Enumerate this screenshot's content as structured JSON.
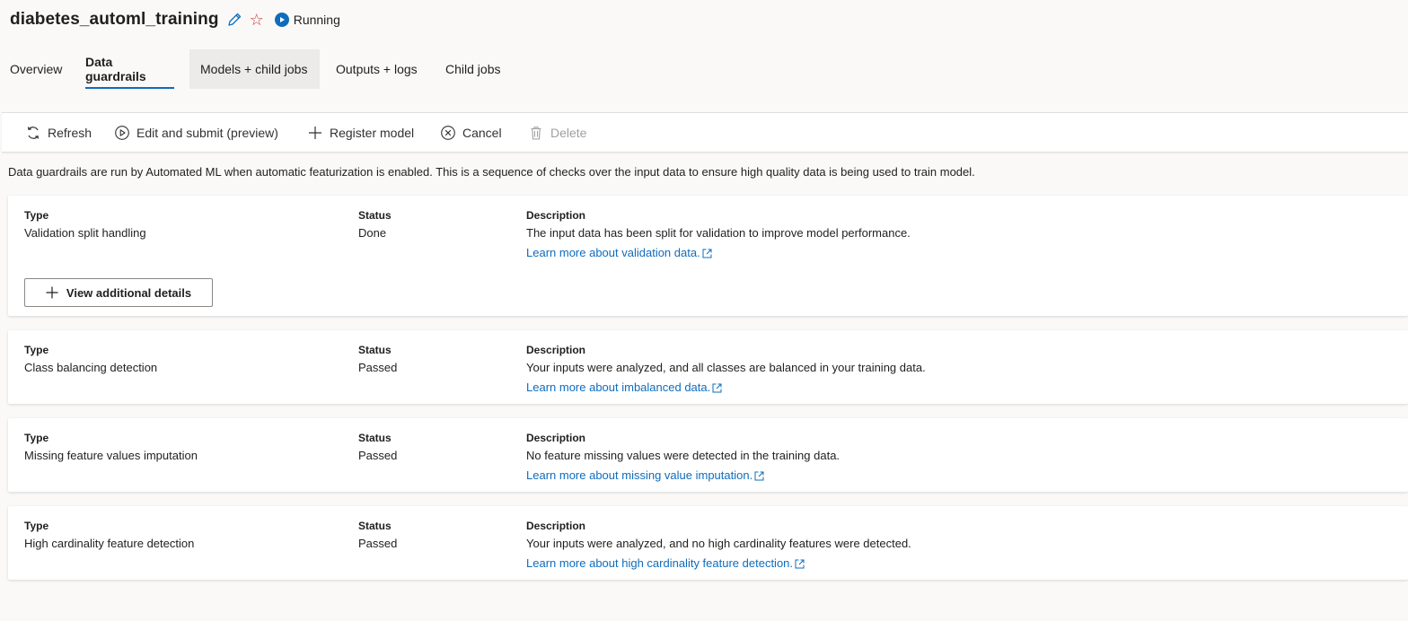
{
  "header": {
    "job_name": "diabetes_automl_training",
    "status": "Running"
  },
  "tabs": [
    {
      "label": "Overview"
    },
    {
      "label": "Data guardrails"
    },
    {
      "label": "Models + child jobs"
    },
    {
      "label": "Outputs + logs"
    },
    {
      "label": "Child jobs"
    }
  ],
  "toolbar": {
    "refresh": "Refresh",
    "edit_submit": "Edit and submit (preview)",
    "register_model": "Register model",
    "cancel": "Cancel",
    "delete": "Delete"
  },
  "intro": "Data guardrails are run by Automated ML when automatic featurization is enabled. This is a sequence of checks over the input data to ensure high quality data is being used to train model.",
  "columns": {
    "type": "Type",
    "status": "Status",
    "description": "Description"
  },
  "guardrails": [
    {
      "type": "Validation split handling",
      "status": "Done",
      "description": "The input data has been split for validation to improve model performance.",
      "link": "Learn more about validation data.",
      "details_button": "View additional details"
    },
    {
      "type": "Class balancing detection",
      "status": "Passed",
      "description": "Your inputs were analyzed, and all classes are balanced in your training data.",
      "link": "Learn more about imbalanced data."
    },
    {
      "type": "Missing feature values imputation",
      "status": "Passed",
      "description": "No feature missing values were detected in the training data.",
      "link": "Learn more about missing value imputation."
    },
    {
      "type": "High cardinality feature detection",
      "status": "Passed",
      "description": "Your inputs were analyzed, and no high cardinality features were detected.",
      "link": "Learn more about high cardinality feature detection."
    }
  ],
  "colors": {
    "accent": "#0f6cbd",
    "favorite_star": "#d13438",
    "disabled_text": "#a19f9d"
  }
}
